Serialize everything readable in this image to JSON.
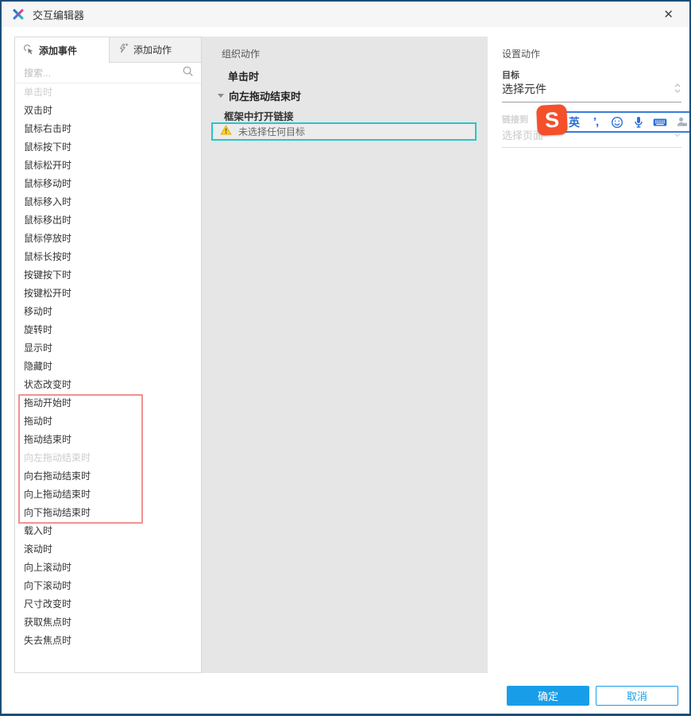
{
  "colors": {
    "navy": "#1d4e77",
    "accent": "#189ee9",
    "teal": "#25c6c9",
    "red": "#f49090",
    "sogou": "#f4502a",
    "imeblue": "#2a6fd8",
    "panelgray": "#e6e6e6"
  },
  "window": {
    "title": "交互编辑器",
    "close_glyph": "✕"
  },
  "tabs": {
    "add_event": "添加事件",
    "add_action": "添加动作"
  },
  "search": {
    "placeholder": "搜索..."
  },
  "events": {
    "items": [
      {
        "label": "单击时",
        "disabled": true
      },
      {
        "label": "双击时"
      },
      {
        "label": "鼠标右击时"
      },
      {
        "label": "鼠标按下时"
      },
      {
        "label": "鼠标松开时"
      },
      {
        "label": "鼠标移动时"
      },
      {
        "label": "鼠标移入时"
      },
      {
        "label": "鼠标移出时"
      },
      {
        "label": "鼠标停放时"
      },
      {
        "label": "鼠标长按时"
      },
      {
        "label": "按键按下时"
      },
      {
        "label": "按键松开时"
      },
      {
        "label": "移动时"
      },
      {
        "label": "旋转时"
      },
      {
        "label": "显示时"
      },
      {
        "label": "隐藏时"
      },
      {
        "label": "状态改变时"
      },
      {
        "label": "拖动开始时"
      },
      {
        "label": "拖动时"
      },
      {
        "label": "拖动结束时"
      },
      {
        "label": "向左拖动结束时",
        "disabled": true
      },
      {
        "label": "向右拖动结束时"
      },
      {
        "label": "向上拖动结束时"
      },
      {
        "label": "向下拖动结束时"
      },
      {
        "label": "载入时"
      },
      {
        "label": "滚动时"
      },
      {
        "label": "向上滚动时"
      },
      {
        "label": "向下滚动时"
      },
      {
        "label": "尺寸改变时"
      },
      {
        "label": "获取焦点时"
      },
      {
        "label": "失去焦点时"
      }
    ]
  },
  "organize": {
    "header": "组织动作",
    "click_event": "单击时",
    "drag_event": "向左拖动结束时",
    "action": "框架中打开链接",
    "warning": "未选择任何目标"
  },
  "settings": {
    "header": "设置动作",
    "target_label": "目标",
    "target_value": "选择元件",
    "link_label": "链接到",
    "page_value": "选择页面"
  },
  "ime": {
    "logo": "S",
    "lang": "英",
    "punct": "’,"
  },
  "footer": {
    "ok": "确定",
    "cancel": "取消"
  }
}
